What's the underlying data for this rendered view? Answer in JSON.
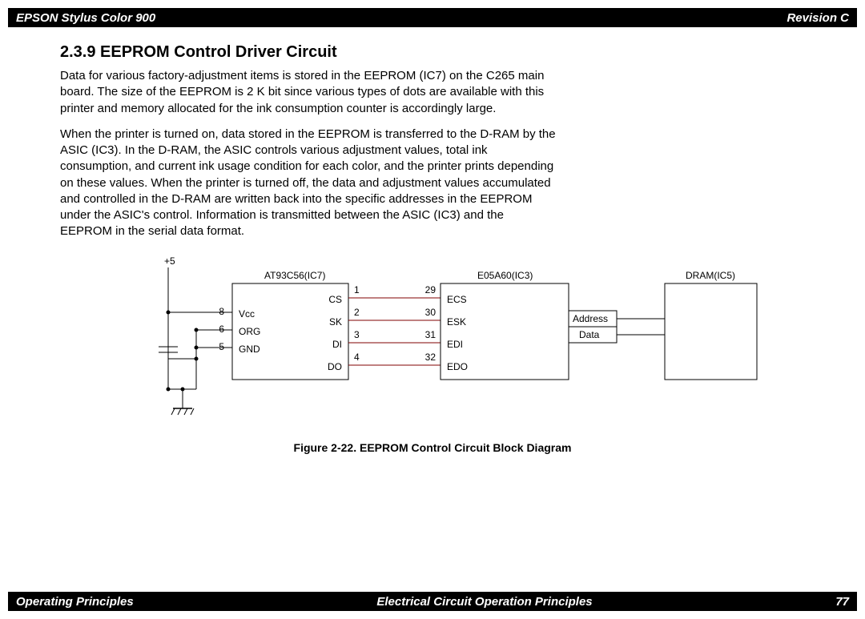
{
  "header": {
    "left": "EPSON Stylus Color 900",
    "right": "Revision C"
  },
  "footer": {
    "left": "Operating Principles",
    "center": "Electrical Circuit Operation Principles",
    "right": "77"
  },
  "section": {
    "number_title": "2.3.9  EEPROM Control Driver Circuit",
    "para1": "Data for various factory-adjustment items is stored in the EEPROM (IC7) on the C265 main board. The size of the EEPROM is 2 K bit since various types of dots are available with this printer and memory allocated for the ink consumption counter is accordingly large.",
    "para2": "When the printer is turned on, data stored in the EEPROM is transferred to the D-RAM by the ASIC (IC3). In the D-RAM, the ASIC controls various adjustment values, total ink consumption, and current ink usage condition for each color, and the printer prints depending on these values. When the printer is turned off, the data and adjustment values accumulated and controlled in the D-RAM are written back into the specific addresses in the EEPROM under the ASIC's control. Information is transmitted between the ASIC (IC3) and the EEPROM in the serial data format."
  },
  "figure": {
    "caption": "Figure 2-22.  EEPROM Control Circuit Block Diagram",
    "labels": {
      "plus5": "+5",
      "ic7_title": "AT93C56(IC7)",
      "ic3_title": "E05A60(IC3)",
      "ic5_title": "DRAM(IC5)",
      "vcc": "Vcc",
      "org": "ORG",
      "gnd": "GND",
      "cs": "CS",
      "sk": "SK",
      "di": "DI",
      "do": "DO",
      "ecs": "ECS",
      "esk": "ESK",
      "edi": "EDI",
      "edo": "EDO",
      "address": "Address",
      "data_lbl": "Data",
      "p8": "8",
      "p6": "6",
      "p5": "5",
      "p1": "1",
      "p2": "2",
      "p3": "3",
      "p4": "4",
      "p29": "29",
      "p30": "30",
      "p31": "31",
      "p32": "32"
    }
  }
}
